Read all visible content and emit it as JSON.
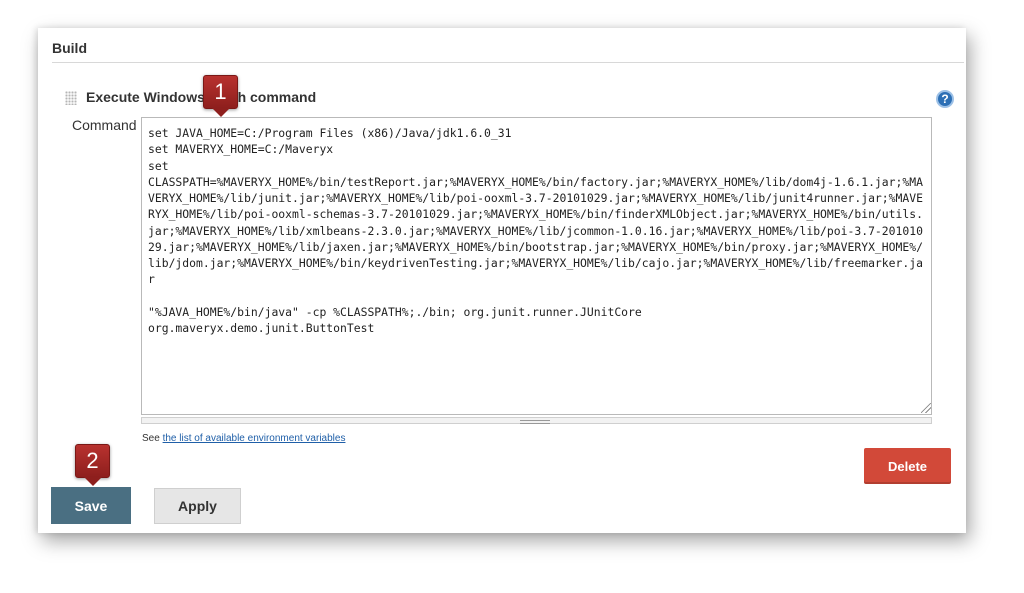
{
  "section": {
    "title": "Build"
  },
  "step": {
    "title": "Execute Windows batch command",
    "command_label": "Command",
    "command_value": "set JAVA_HOME=C:/Program Files (x86)/Java/jdk1.6.0_31\nset MAVERYX_HOME=C:/Maveryx\nset\nCLASSPATH=%MAVERYX_HOME%/bin/testReport.jar;%MAVERYX_HOME%/bin/factory.jar;%MAVERYX_HOME%/lib/dom4j-1.6.1.jar;%MAVERYX_HOME%/lib/junit.jar;%MAVERYX_HOME%/lib/poi-ooxml-3.7-20101029.jar;%MAVERYX_HOME%/lib/junit4runner.jar;%MAVERYX_HOME%/lib/poi-ooxml-schemas-3.7-20101029.jar;%MAVERYX_HOME%/bin/finderXMLObject.jar;%MAVERYX_HOME%/bin/utils.jar;%MAVERYX_HOME%/lib/xmlbeans-2.3.0.jar;%MAVERYX_HOME%/lib/jcommon-1.0.16.jar;%MAVERYX_HOME%/lib/poi-3.7-20101029.jar;%MAVERYX_HOME%/lib/jaxen.jar;%MAVERYX_HOME%/bin/bootstrap.jar;%MAVERYX_HOME%/bin/proxy.jar;%MAVERYX_HOME%/lib/jdom.jar;%MAVERYX_HOME%/bin/keydrivenTesting.jar;%MAVERYX_HOME%/lib/cajo.jar;%MAVERYX_HOME%/lib/freemarker.jar\n\n\"%JAVA_HOME%/bin/java\" -cp %CLASSPATH%;./bin; org.junit.runner.JUnitCore\norg.maveryx.demo.junit.ButtonTest",
    "env_note_prefix": "See",
    "env_link_text": "the list of available environment variables",
    "delete_label": "Delete",
    "help_glyph": "?"
  },
  "footer": {
    "save_label": "Save",
    "apply_label": "Apply"
  },
  "callouts": {
    "first": "1",
    "second": "2"
  },
  "colors": {
    "delete": "#d24939",
    "save": "#4a6f82",
    "callout": "#a52a27",
    "link": "#1f5fa8"
  }
}
